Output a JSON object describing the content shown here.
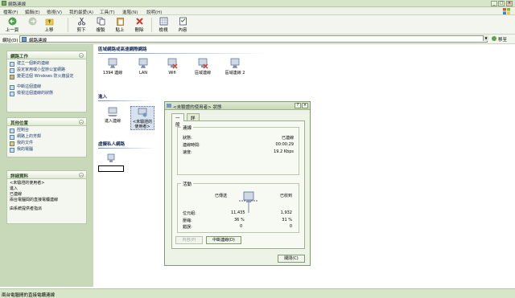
{
  "window": {
    "title": "網路連線",
    "min": "_",
    "max": "□",
    "close": "×"
  },
  "menu": [
    "檔案(F)",
    "編輯(E)",
    "檢視(V)",
    "我的最愛(A)",
    "工具(T)",
    "進階(N)",
    "說明(H)"
  ],
  "toolbar": {
    "back": "上一頁",
    "forward": "",
    "up": "上移",
    "cut": "剪下",
    "copy": "複製",
    "paste": "貼上",
    "delete": "刪除",
    "views": "檢視",
    "properties": "內容"
  },
  "address": {
    "label": "網址(D)",
    "value": "網路連線",
    "go": "移至"
  },
  "left": {
    "network_tasks": {
      "title": "網路工作",
      "items": [
        "建立一個新的連線",
        "設定家用或小型辦公室網路",
        "變更這個 Windows 防火牆設定",
        "中斷這個連線",
        "檢視這個連線的狀態"
      ]
    },
    "other_places": {
      "title": "其他位置",
      "items": [
        "控制台",
        "網路上的芳鄰",
        "我的文件",
        "我的電腦"
      ]
    },
    "details": {
      "title": "詳細資料",
      "lines": [
        "<未驗證的使用者>",
        "進入",
        "已連線",
        "兩台電腦間的直接電纜連線",
        "",
        "由系統提供者指派"
      ]
    }
  },
  "content": {
    "lan_section": "區域網路或高速網際網路",
    "lan_items": [
      "1394 連線",
      "LAN",
      "Wifi",
      "區域連線",
      "區域連線 2"
    ],
    "incoming_section": "進入",
    "incoming_items": [
      "進入連線",
      "<未驗證的使用者>"
    ],
    "vpn_section": "虛擬私人網路",
    "vpn_item": ""
  },
  "dialog": {
    "title": "<未驗證的使用者> 狀態",
    "help": "?",
    "close": "×",
    "tabs": [
      "一般",
      "詳細資料"
    ],
    "connection": {
      "label": "連線",
      "status_label": "狀態:",
      "status_value": "已連線",
      "duration_label": "連線時間:",
      "duration_value": "00:00:29",
      "speed_label": "速度:",
      "speed_value": "19.2 Kbps"
    },
    "activity": {
      "label": "活動",
      "sent_label": "已傳送",
      "received_label": "已收到",
      "bytes_label": "位元組:",
      "bytes_sent": "11,435",
      "bytes_received": "1,932",
      "compression_label": "壓縮:",
      "compression_sent": "36 %",
      "compression_received": "31 %",
      "errors_label": "錯誤:",
      "errors_sent": "0",
      "errors_received": "0"
    },
    "properties_btn": "內容(P)",
    "disconnect_btn": "中斷連線(D)",
    "close_btn": "關閉(C)"
  },
  "status": "兩台電腦間的直接電纜連線"
}
